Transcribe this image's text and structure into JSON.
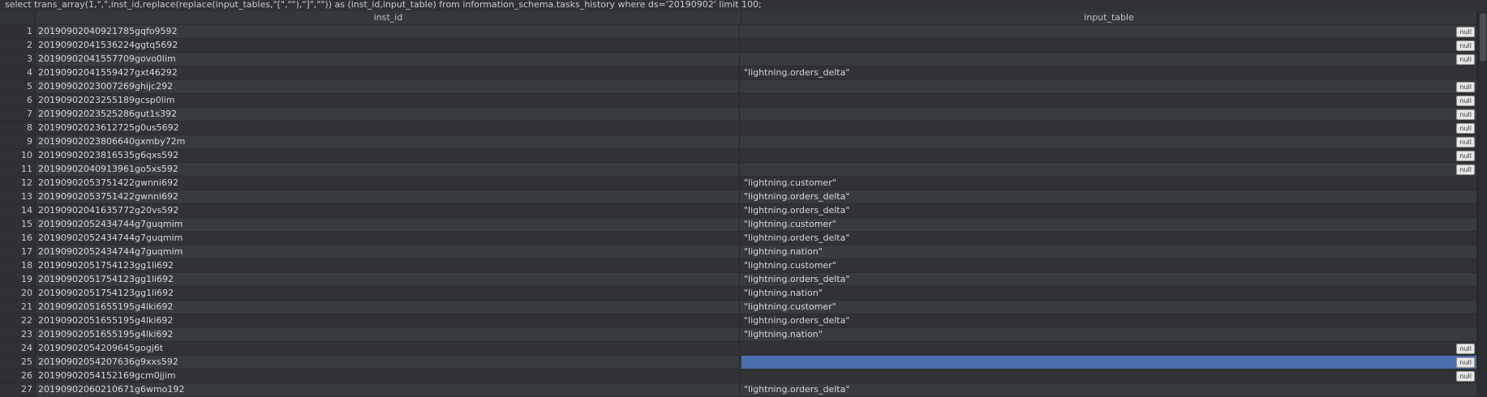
{
  "query": "select trans_array(1,\",\",inst_id,replace(replace(input_tables,\"[\",\"\"),\"]\",\"\")) as (inst_id,input_table) from information_schema.tasks_history where ds='20190902' limit 100;",
  "columns": {
    "inst_id": "inst_id",
    "input_table": "input_table"
  },
  "null_label": "null",
  "rows": [
    {
      "n": "1",
      "inst_id": "20190902040921785gqfo9592",
      "input_table": "",
      "is_null": true
    },
    {
      "n": "2",
      "inst_id": "20190902041536224ggtq5692",
      "input_table": "",
      "is_null": true
    },
    {
      "n": "3",
      "inst_id": "20190902041557709govo0lim",
      "input_table": "",
      "is_null": true
    },
    {
      "n": "4",
      "inst_id": "20190902041559427gxt46292",
      "input_table": "\"lightning.orders_delta\"",
      "is_null": false
    },
    {
      "n": "5",
      "inst_id": "20190902023007269ghijc292",
      "input_table": "",
      "is_null": true
    },
    {
      "n": "6",
      "inst_id": "20190902023255189gcsp0lim",
      "input_table": "",
      "is_null": true
    },
    {
      "n": "7",
      "inst_id": "20190902023525286gut1s392",
      "input_table": "",
      "is_null": true
    },
    {
      "n": "8",
      "inst_id": "20190902023612725g0us5692",
      "input_table": "",
      "is_null": true
    },
    {
      "n": "9",
      "inst_id": "20190902023806640gxmby72m",
      "input_table": "",
      "is_null": true
    },
    {
      "n": "10",
      "inst_id": "20190902023816535g6qxs592",
      "input_table": "",
      "is_null": true
    },
    {
      "n": "11",
      "inst_id": "20190902040913961go5xs592",
      "input_table": "",
      "is_null": true
    },
    {
      "n": "12",
      "inst_id": "20190902053751422gwnni692",
      "input_table": "\"lightning.customer\"",
      "is_null": false
    },
    {
      "n": "13",
      "inst_id": "20190902053751422gwnni692",
      "input_table": "\"lightning.orders_delta\"",
      "is_null": false
    },
    {
      "n": "14",
      "inst_id": "20190902041635772g20vs592",
      "input_table": "\"lightning.orders_delta\"",
      "is_null": false
    },
    {
      "n": "15",
      "inst_id": "20190902052434744g7guqmim",
      "input_table": "\"lightning.customer\"",
      "is_null": false
    },
    {
      "n": "16",
      "inst_id": "20190902052434744g7guqmim",
      "input_table": "\"lightning.orders_delta\"",
      "is_null": false
    },
    {
      "n": "17",
      "inst_id": "20190902052434744g7guqmim",
      "input_table": "\"lightning.nation\"",
      "is_null": false
    },
    {
      "n": "18",
      "inst_id": "20190902051754123gg1li692",
      "input_table": "\"lightning.customer\"",
      "is_null": false
    },
    {
      "n": "19",
      "inst_id": "20190902051754123gg1li692",
      "input_table": "\"lightning.orders_delta\"",
      "is_null": false
    },
    {
      "n": "20",
      "inst_id": "20190902051754123gg1li692",
      "input_table": "\"lightning.nation\"",
      "is_null": false
    },
    {
      "n": "21",
      "inst_id": "20190902051655195g4lki692",
      "input_table": "\"lightning.customer\"",
      "is_null": false
    },
    {
      "n": "22",
      "inst_id": "20190902051655195g4lki692",
      "input_table": "\"lightning.orders_delta\"",
      "is_null": false
    },
    {
      "n": "23",
      "inst_id": "20190902051655195g4lki692",
      "input_table": "\"lightning.nation\"",
      "is_null": false
    },
    {
      "n": "24",
      "inst_id": "20190902054209645gogj6t",
      "input_table": "",
      "is_null": true
    },
    {
      "n": "25",
      "inst_id": "20190902054207636g9xxs592",
      "input_table": "",
      "is_null": true,
      "selected": true
    },
    {
      "n": "26",
      "inst_id": "20190902054152169gcm0jjim",
      "input_table": "",
      "is_null": true
    },
    {
      "n": "27",
      "inst_id": "20190902060210671g6wmo192",
      "input_table": "\"lightning.orders_delta\"",
      "is_null": false
    }
  ]
}
